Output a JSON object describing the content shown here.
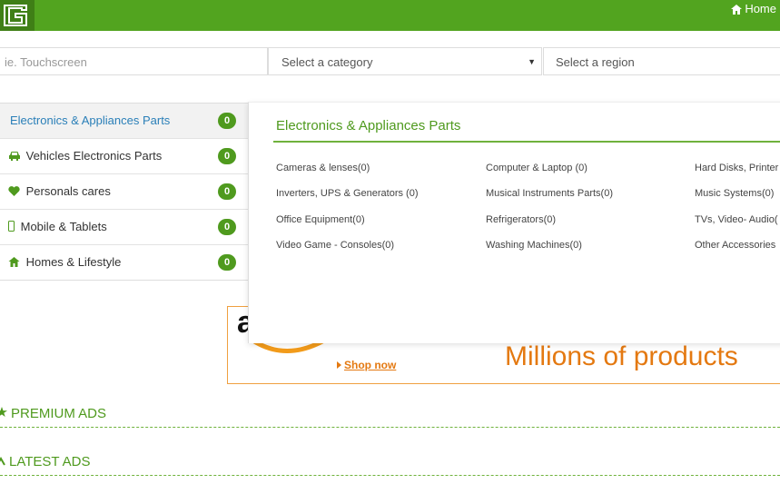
{
  "header": {
    "logo_icon": "g-logo-icon",
    "home_label": "Home",
    "home_icon": "home-icon",
    "brand_color": "#52a41f"
  },
  "search": {
    "keyword_placeholder": "ie. Touchscreen",
    "category_value": "Select a category",
    "region_value": "Select a region"
  },
  "categories": [
    {
      "label": "Electronics & Appliances Parts",
      "count": "0",
      "icon": "none"
    },
    {
      "label": "Vehicles Electronics Parts",
      "count": "0",
      "icon": "car-icon"
    },
    {
      "label": "Personals cares",
      "count": "0",
      "icon": "heart-icon"
    },
    {
      "label": "Mobile & Tablets",
      "count": "0",
      "icon": "mobile-icon"
    },
    {
      "label": "Homes & Lifestyle",
      "count": "0",
      "icon": "home-icon"
    }
  ],
  "dropdown": {
    "title": "Electronics & Appliances Parts",
    "subcategories": [
      [
        "Cameras & lenses(0)",
        "Computer & Laptop (0)",
        "Hard Disks, Printer"
      ],
      [
        "Inverters, UPS & Generators (0)",
        "Musical Instruments Parts(0)",
        "Music Systems(0)"
      ],
      [
        "Office Equipment(0)",
        "Refrigerators(0)",
        "TVs, Video- Audio("
      ],
      [
        "Video Game - Consoles(0)",
        "Washing Machines(0)",
        "Other Accessories"
      ]
    ]
  },
  "banner": {
    "logo_letter": "a",
    "shop_label": "Shop now",
    "tagline": "Millions of products",
    "accent_color": "#e47911"
  },
  "sections": {
    "premium": "PREMIUM ADS",
    "latest": "LATEST ADS"
  }
}
